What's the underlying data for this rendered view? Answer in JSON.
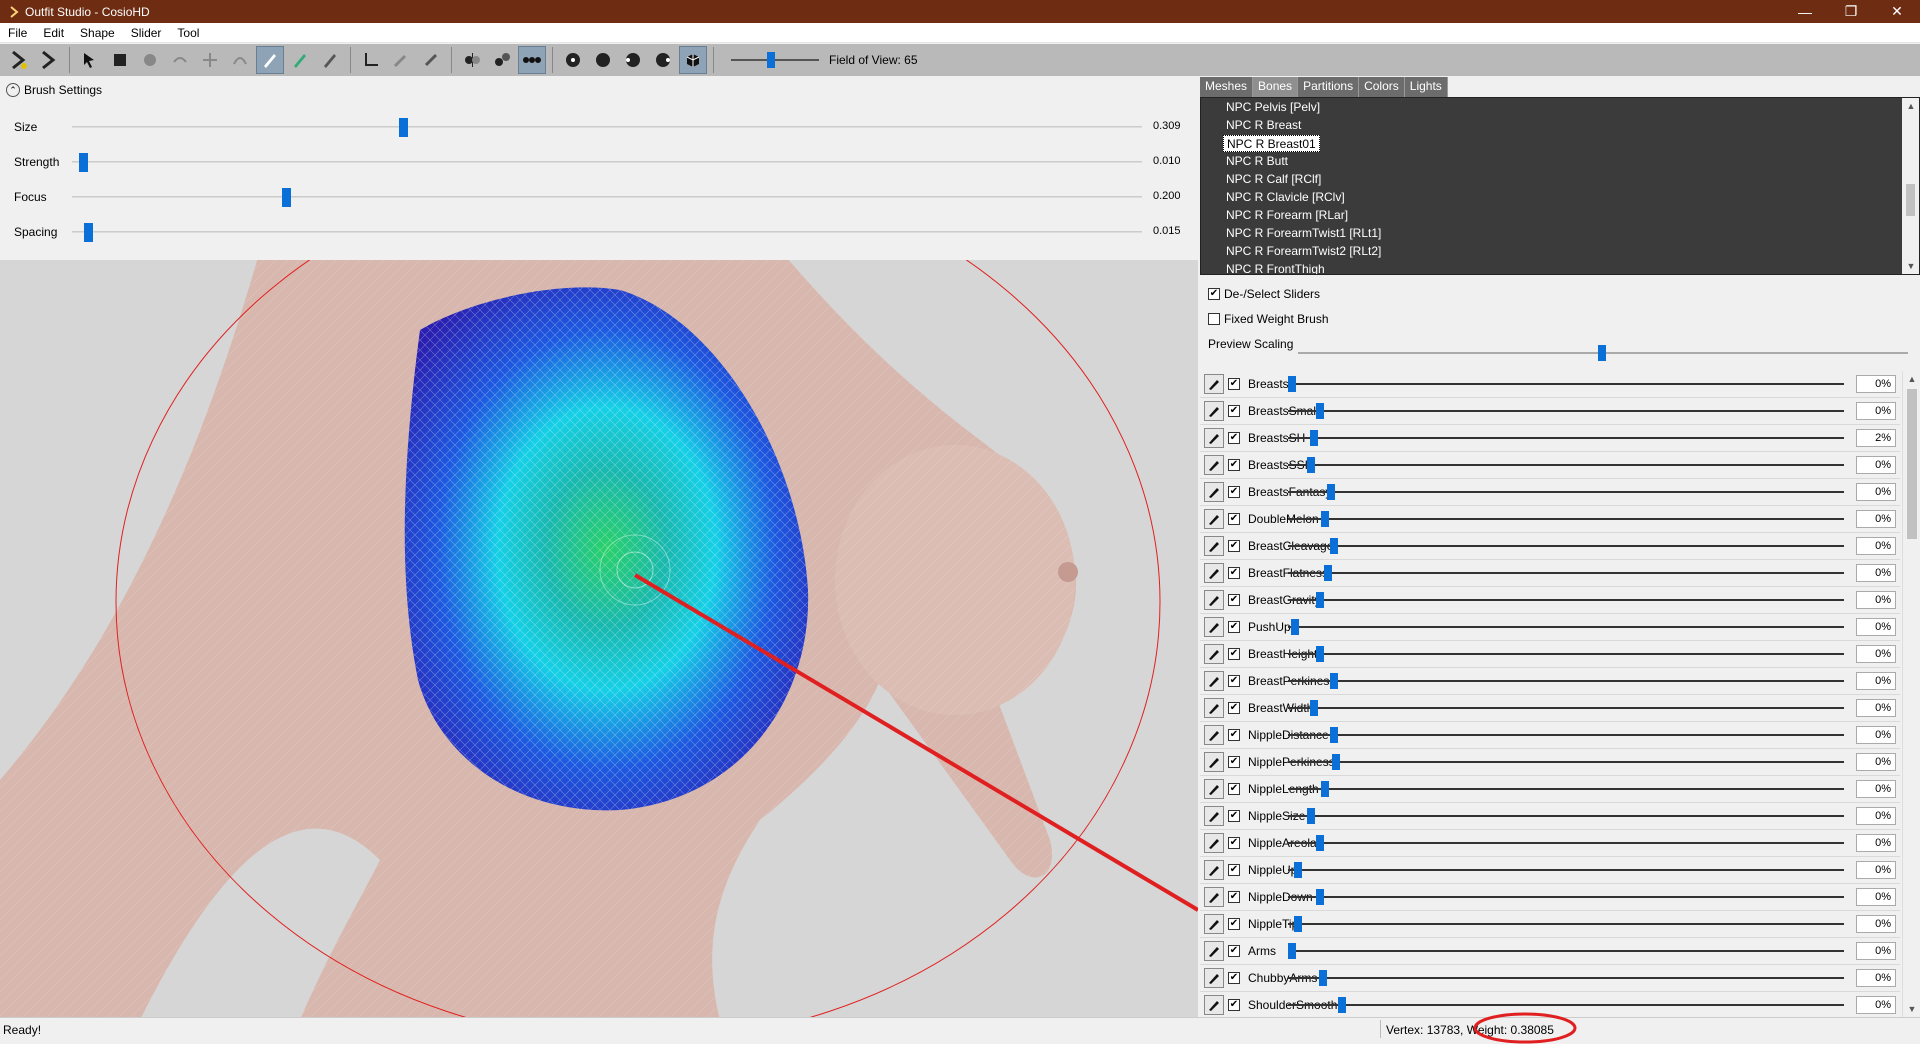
{
  "window": {
    "title": "Outfit Studio - CosioHD"
  },
  "menu": [
    "File",
    "Edit",
    "Shape",
    "Slider",
    "Tool"
  ],
  "toolbar": {
    "fov_label": "Field of View: 65"
  },
  "brush_settings": {
    "header": "Brush Settings",
    "rows": [
      {
        "label": "Size",
        "value": "0.309",
        "level": 0.309
      },
      {
        "label": "Strength",
        "value": "0.010",
        "level": 0.01
      },
      {
        "label": "Focus",
        "value": "0.200",
        "level": 0.2
      },
      {
        "label": "Spacing",
        "value": "0.015",
        "level": 0.015
      }
    ]
  },
  "tabs": [
    {
      "label": "Meshes",
      "active": false
    },
    {
      "label": "Bones",
      "active": true
    },
    {
      "label": "Partitions",
      "active": false
    },
    {
      "label": "Colors",
      "active": false
    },
    {
      "label": "Lights",
      "active": false
    }
  ],
  "bones": [
    "NPC Pelvis [Pelv]",
    "NPC R Breast",
    "NPC R Breast01",
    "NPC R Butt",
    "NPC R Calf [RClf]",
    "NPC R Clavicle [RClv]",
    "NPC R Forearm [RLar]",
    "NPC R ForearmTwist1 [RLt1]",
    "NPC R ForearmTwist2 [RLt2]",
    "NPC R FrontThigh"
  ],
  "selected_bone_index": 2,
  "options": {
    "deselect_sliders": "De-/Select Sliders",
    "fixed_weight_brush": "Fixed Weight Brush",
    "preview_scaling": "Preview Scaling"
  },
  "sliders": [
    {
      "name": "Breasts",
      "value": "0%",
      "pos": 0.0
    },
    {
      "name": "BreastsSmall",
      "value": "0%",
      "pos": 0.05
    },
    {
      "name": "BreastsSH",
      "value": "2%",
      "pos": 0.04
    },
    {
      "name": "BreastsSSH",
      "value": "0%",
      "pos": 0.035
    },
    {
      "name": "BreastsFantasy",
      "value": "0%",
      "pos": 0.07
    },
    {
      "name": "DoubleMelon",
      "value": "0%",
      "pos": 0.06
    },
    {
      "name": "BreastCleavage",
      "value": "0%",
      "pos": 0.075
    },
    {
      "name": "BreastFlatness",
      "value": "0%",
      "pos": 0.065
    },
    {
      "name": "BreastGravity",
      "value": "0%",
      "pos": 0.05
    },
    {
      "name": "PushUp",
      "value": "0%",
      "pos": 0.005
    },
    {
      "name": "BreastHeight",
      "value": "0%",
      "pos": 0.05
    },
    {
      "name": "BreastPerkiness",
      "value": "0%",
      "pos": 0.075
    },
    {
      "name": "BreastWidth",
      "value": "0%",
      "pos": 0.04
    },
    {
      "name": "NippleDistance",
      "value": "0%",
      "pos": 0.075
    },
    {
      "name": "NipplePerkiness",
      "value": "0%",
      "pos": 0.08
    },
    {
      "name": "NippleLength",
      "value": "0%",
      "pos": 0.06
    },
    {
      "name": "NippleSize",
      "value": "0%",
      "pos": 0.035
    },
    {
      "name": "NippleAreola",
      "value": "0%",
      "pos": 0.05
    },
    {
      "name": "NippleUp",
      "value": "0%",
      "pos": 0.01
    },
    {
      "name": "NippleDown",
      "value": "0%",
      "pos": 0.05
    },
    {
      "name": "NippleTip",
      "value": "0%",
      "pos": 0.01
    },
    {
      "name": "Arms",
      "value": "0%",
      "pos": 0.0
    },
    {
      "name": "ChubbyArms",
      "value": "0%",
      "pos": 0.055
    },
    {
      "name": "ShoulderSmooth",
      "value": "0%",
      "pos": 0.09
    }
  ],
  "status": {
    "left": "Ready!",
    "right": "Vertex: 13783, Weight: 0.38085"
  },
  "colors": {
    "titlebar": "#6e2c12",
    "accent": "#0a6fd6",
    "toolbar": "#b9b9b9",
    "bones_bg": "#3b3b3b",
    "viewport_bg": "#d6d6d6",
    "annotation": "#e02020"
  }
}
